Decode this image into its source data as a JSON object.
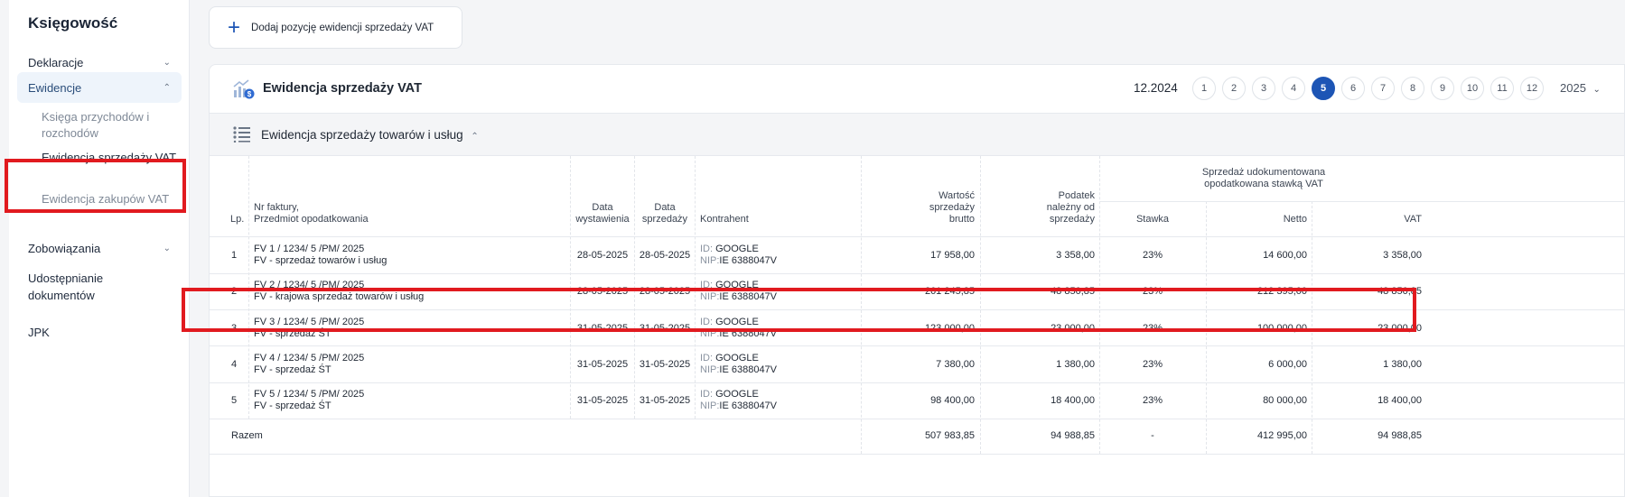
{
  "sidebar": {
    "title": "Księgowość",
    "items": [
      {
        "label": "Deklaracje"
      },
      {
        "label": "Ewidencje"
      },
      {
        "label": "Zobowiązania"
      },
      {
        "label": "Udostępnianie dokumentów"
      },
      {
        "label": "JPK"
      }
    ],
    "subitems": [
      {
        "label": "Księga przychodów i rozchodów"
      },
      {
        "label": "Ewidencja sprzedaży VAT"
      },
      {
        "label": "Ewidencja zakupów VAT"
      }
    ]
  },
  "toolbar": {
    "add_label": "Dodaj pozycję ewidencji sprzedaży VAT"
  },
  "panel": {
    "title": "Ewidencja sprzedaży VAT",
    "period": "12.2024",
    "months": [
      "1",
      "2",
      "3",
      "4",
      "5",
      "6",
      "7",
      "8",
      "9",
      "10",
      "11",
      "12"
    ],
    "active_month": "5",
    "year": "2025",
    "section_title": "Ewidencja sprzedaży towarów i usług"
  },
  "colors": {
    "accent": "#1d55b5",
    "highlight": "#e11a1f"
  },
  "table": {
    "headers": {
      "lp": "Lp.",
      "nr_line1": "Nr faktury,",
      "nr_line2": "Przedmiot opodatkowania",
      "data_wyst_1": "Data",
      "data_wyst_2": "wystawienia",
      "data_sprz_1": "Data",
      "data_sprz_2": "sprzedaży",
      "kontrahent": "Kontrahent",
      "wartosc_1": "Wartość",
      "wartosc_2": "sprzedaży",
      "wartosc_3": "brutto",
      "podatek_1": "Podatek",
      "podatek_2": "należny od",
      "podatek_3": "sprzedaży",
      "group_1": "Sprzedaż udokumentowana",
      "group_2": "opodatkowana stawką VAT",
      "stawka": "Stawka",
      "netto": "Netto",
      "vat": "VAT"
    },
    "id_label": "ID:",
    "nip_label": "NIP:",
    "rows": [
      {
        "lp": "1",
        "nr": "FV 1 / 1234/ 5 /PM/ 2025",
        "przedmiot": "FV - sprzedaż towarów i usług",
        "data_wyst": "28-05-2025",
        "data_sprz": "28-05-2025",
        "id": "GOOGLE",
        "nip": "IE 6388047V",
        "brutto": "17 958,00",
        "podatek": "3 358,00",
        "stawka": "23%",
        "netto": "14 600,00",
        "vat": "3 358,00"
      },
      {
        "lp": "2",
        "nr": "FV 2 / 1234/ 5 /PM/ 2025",
        "przedmiot": "FV - krajowa sprzedaż towarów i usług",
        "data_wyst": "28-05-2025",
        "data_sprz": "28-05-2025",
        "id": "GOOGLE",
        "nip": "IE 6388047V",
        "brutto": "261 245,85",
        "podatek": "48 850,85",
        "stawka": "23%",
        "netto": "212 395,00",
        "vat": "48 850,85"
      },
      {
        "lp": "3",
        "nr": "FV 3 / 1234/ 5 /PM/ 2025",
        "przedmiot": "FV - sprzedaż ŚT",
        "data_wyst": "31-05-2025",
        "data_sprz": "31-05-2025",
        "id": "GOOGLE",
        "nip": "IE 6388047V",
        "brutto": "123 000,00",
        "podatek": "23 000,00",
        "stawka": "23%",
        "netto": "100 000,00",
        "vat": "23 000,00"
      },
      {
        "lp": "4",
        "nr": "FV 4 / 1234/ 5 /PM/ 2025",
        "przedmiot": "FV - sprzedaż ŚT",
        "data_wyst": "31-05-2025",
        "data_sprz": "31-05-2025",
        "id": "GOOGLE",
        "nip": "IE 6388047V",
        "brutto": "7 380,00",
        "podatek": "1 380,00",
        "stawka": "23%",
        "netto": "6 000,00",
        "vat": "1 380,00"
      },
      {
        "lp": "5",
        "nr": "FV 5 / 1234/ 5 /PM/ 2025",
        "przedmiot": "FV - sprzedaż ŚT",
        "data_wyst": "31-05-2025",
        "data_sprz": "31-05-2025",
        "id": "GOOGLE",
        "nip": "IE 6388047V",
        "brutto": "98 400,00",
        "podatek": "18 400,00",
        "stawka": "23%",
        "netto": "80 000,00",
        "vat": "18 400,00"
      }
    ],
    "total": {
      "label": "Razem",
      "brutto": "507 983,85",
      "podatek": "94 988,85",
      "stawka": "-",
      "netto": "412 995,00",
      "vat": "94 988,85"
    }
  }
}
